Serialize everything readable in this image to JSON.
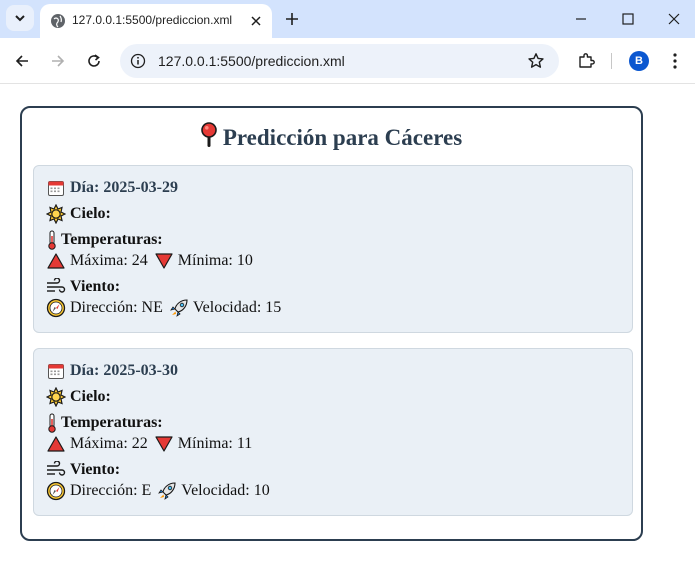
{
  "browser": {
    "tab_title": "127.0.0.1:5500/prediccion.xml",
    "url": "127.0.0.1:5500/prediccion.xml",
    "profile_initial": "B"
  },
  "page": {
    "title": "Predicción para Cáceres",
    "days": [
      {
        "label": "Día: 2025-03-29",
        "cielo_label": "Cielo:",
        "temp_label": "Temperaturas:",
        "max_label": "Máxima: 24",
        "min_label": "Mínima: 10",
        "viento_label": "Viento:",
        "direccion_label": "Dirección: NE",
        "velocidad_label": "Velocidad: 15"
      },
      {
        "label": "Día: 2025-03-30",
        "cielo_label": "Cielo:",
        "temp_label": "Temperaturas:",
        "max_label": "Máxima: 22",
        "min_label": "Mínima: 11",
        "viento_label": "Viento:",
        "direccion_label": "Dirección: E",
        "velocidad_label": "Velocidad: 10"
      }
    ]
  },
  "icons": {
    "title": "round-pushpin-icon",
    "day": "calendar-icon",
    "sky": "sun-icon",
    "temperature": "thermometer-icon",
    "max": "red-triangle-up-icon",
    "min": "red-triangle-down-icon",
    "wind": "wind-blowing-face-icon",
    "direction": "compass-icon",
    "speed": "rocket-icon"
  },
  "colors": {
    "heading": "#2c3e50",
    "card_bg": "#eaf0f6",
    "tabstrip": "#d3e3fd",
    "accent_red": "#e53935"
  }
}
